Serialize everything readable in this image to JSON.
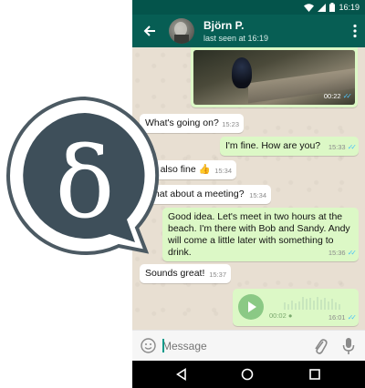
{
  "status_bar": {
    "time": "16:19"
  },
  "header": {
    "contact_name": "Björn P.",
    "last_seen": "last seen at 16:19"
  },
  "image_message": {
    "time": "00:22"
  },
  "messages": [
    {
      "text": "What's going on?",
      "time": "15:23",
      "direction": "in"
    },
    {
      "text": "I'm fine. How are you?",
      "time": "15:33",
      "direction": "out"
    },
    {
      "text": "I'm also fine 👍",
      "time": "15:34",
      "direction": "in"
    },
    {
      "text": "What about a meeting?",
      "time": "15:34",
      "direction": "in"
    },
    {
      "text": "Good idea. Let's meet in two hours at the beach. I'm there with Bob and Sandy. Andy will come a little later with something to drink.",
      "time": "15:36",
      "direction": "out"
    },
    {
      "text": "Sounds great!",
      "time": "15:37",
      "direction": "in"
    }
  ],
  "voice_message": {
    "duration": "00:02",
    "time": "16:01"
  },
  "input": {
    "placeholder": "Message"
  },
  "logo": {
    "glyph": "δ"
  },
  "colors": {
    "header": "#075e54",
    "status_bar": "#04544b",
    "outgoing_bubble": "#dcf8c6",
    "incoming_bubble": "#ffffff",
    "read_ticks": "#4fc3f7",
    "voice_play": "#8bc985",
    "logo_fill": "#3e4f5a"
  },
  "icons": [
    "arrow-back-icon",
    "more-vert-icon",
    "emoji-icon",
    "attach-icon",
    "mic-icon",
    "play-icon",
    "nav-back-icon",
    "nav-home-icon",
    "nav-recent-icon",
    "wifi-icon",
    "signal-icon",
    "battery-icon"
  ]
}
